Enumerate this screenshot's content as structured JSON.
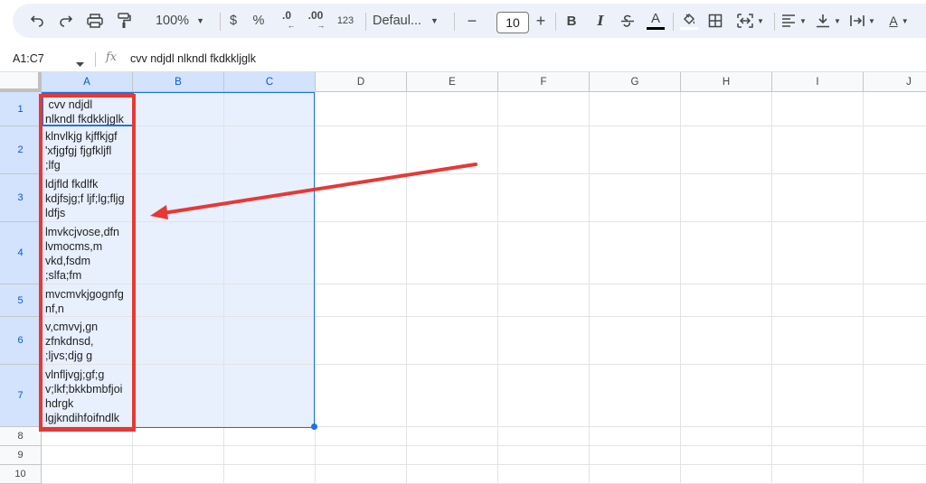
{
  "toolbar": {
    "zoom": "100%",
    "currency": "$",
    "percent": "%",
    "decrease_decimal": ".0",
    "increase_decimal": ".00",
    "number_format": "123",
    "font_family": "Defaul...",
    "font_size": "10",
    "bold": "B",
    "italic": "I",
    "text_color_letter": "A",
    "text_rotation_letter": "A"
  },
  "formula_bar": {
    "name_box": "A1:C7",
    "fx_label": "fx",
    "formula": "cvv ndjdl nlkndl fkdkkljglk"
  },
  "columns": [
    "A",
    "B",
    "C",
    "D",
    "E",
    "F",
    "G",
    "H",
    "I",
    "J"
  ],
  "selected_columns": [
    "A",
    "B",
    "C"
  ],
  "rows": [
    "1",
    "2",
    "3",
    "4",
    "5",
    "6",
    "7",
    "8",
    "9",
    "10"
  ],
  "cells_a": [
    " cvv ndjdl\nnlkndl fkdkkljglk",
    "klnvlkjg kjffkjgf\n'xfjgfgj fjgfkljfl\n;lfg",
    "ldjfld fkdlfk\nkdjfsjg;f ljf;lg;fljg\nldfjs",
    "lmvkcjvose,dfn\nlvmocms,m\nvkd,fsdm\n;slfa;fm",
    "mvcmvkjgognfg\nnf,n",
    "v,cmvvj,gn\nzfnkdnsd,\n;ljvs;djg g",
    "vlnfljvgj;gf;g\nv;lkf;bkkbmbfjoi\nhdrgk\nlgjkndihfoifndlk"
  ],
  "colors": {
    "accent": "#1a73e8",
    "annotation": "#e53935",
    "toolbar_bg": "#edf2fa",
    "selected_fill": "#e8f0fe"
  }
}
